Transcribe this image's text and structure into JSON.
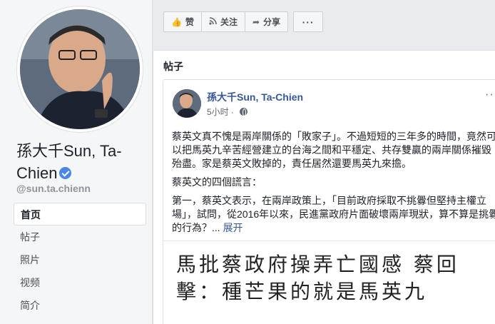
{
  "profile": {
    "name": "孫大千Sun, Ta-Chien",
    "handle": "@sun.ta.chienn"
  },
  "sidebar": {
    "items": [
      {
        "label": "首页",
        "active": true
      },
      {
        "label": "帖子",
        "active": false
      },
      {
        "label": "照片",
        "active": false
      },
      {
        "label": "视频",
        "active": false
      },
      {
        "label": "简介",
        "active": false
      }
    ]
  },
  "actions": {
    "like": "赞",
    "follow": "关注",
    "share": "分享",
    "more": "···"
  },
  "posts_section": {
    "title": "帖子"
  },
  "post": {
    "author": "孫大千Sun, Ta-Chien",
    "time": "5小时",
    "menu": "···",
    "paragraphs": [
      "蔡英文真不愧是兩岸關係的「敗家子」。不過短短的三年多的時間，竟然可以把馬英九辛苦經營建立的台海之間和平穩定、共存雙贏的兩岸關係摧毀殆盡。家是蔡英文敗掉的，責任居然還要馬英九來擔。",
      "蔡英文的四個謊言：",
      "第一，蔡英文表示，在兩岸政策上，「目前政府採取不挑釁但堅持主權立場」，試問，從2016年以來，民進黨政府片面破壞兩岸現狀，算不算是挑釁的行為？..."
    ],
    "see_more": "展开",
    "image_headline": "馬批蔡政府操弄亡國感 蔡回擊：種芒果的就是馬英九"
  },
  "colors": {
    "link": "#365899",
    "background": "#e9ebee",
    "verified": "#4a86e8"
  }
}
